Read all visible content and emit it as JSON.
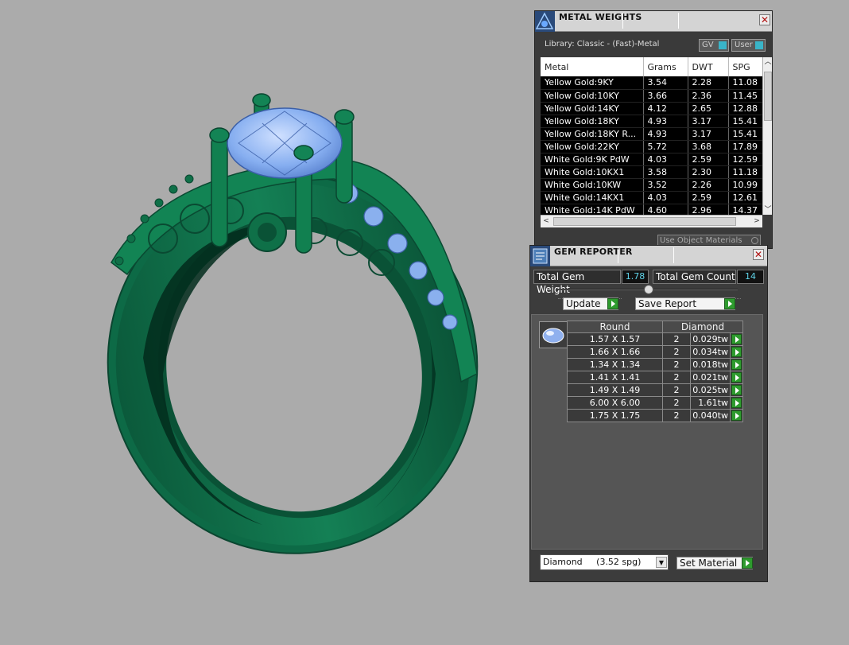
{
  "metal_weights": {
    "title": "METAL WEIGHTS",
    "library": "Library: Classic - (Fast)-Metal",
    "toggle_gv": "GV",
    "toggle_user": "User",
    "columns": [
      "Metal",
      "Grams",
      "DWT",
      "SPG"
    ],
    "rows": [
      [
        "Yellow Gold:9KY",
        "3.54",
        "2.28",
        "11.08"
      ],
      [
        "Yellow Gold:10KY",
        "3.66",
        "2.36",
        "11.45"
      ],
      [
        "Yellow Gold:14KY",
        "4.12",
        "2.65",
        "12.88"
      ],
      [
        "Yellow Gold:18KY",
        "4.93",
        "3.17",
        "15.41"
      ],
      [
        "Yellow Gold:18KY R...",
        "4.93",
        "3.17",
        "15.41"
      ],
      [
        "Yellow Gold:22KY",
        "5.72",
        "3.68",
        "17.89"
      ],
      [
        "White Gold:9K PdW",
        "4.03",
        "2.59",
        "12.59"
      ],
      [
        "White Gold:10KX1",
        "3.58",
        "2.30",
        "11.18"
      ],
      [
        "White Gold:10KW",
        "3.52",
        "2.26",
        "10.99"
      ],
      [
        "White Gold:14KX1",
        "4.03",
        "2.59",
        "12.61"
      ],
      [
        "White Gold:14K PdW",
        "4.60",
        "2.96",
        "14.37"
      ]
    ],
    "use_object_materials": "Use Object Materials"
  },
  "gem_reporter": {
    "title": "GEM REPORTER",
    "total_weight_label": "Total Gem Weight",
    "total_weight_value": "1.78",
    "total_count_label": "Total Gem Count",
    "total_count_value": "14",
    "update_label": "Update",
    "save_report_label": "Save Report",
    "table_headers": [
      "Round",
      "Diamond"
    ],
    "gems": [
      [
        "1.57 X 1.57",
        "2",
        "0.029tw"
      ],
      [
        "1.66 X 1.66",
        "2",
        "0.034tw"
      ],
      [
        "1.34 X 1.34",
        "2",
        "0.018tw"
      ],
      [
        "1.41 X 1.41",
        "2",
        "0.021tw"
      ],
      [
        "1.49 X 1.49",
        "2",
        "0.025tw"
      ],
      [
        "6.00 X 6.00",
        "2",
        "1.61tw"
      ],
      [
        "1.75 X 1.75",
        "2",
        "0.040tw"
      ]
    ],
    "material_select": "Diamond     (3.52 spg)",
    "set_material_label": "Set Material"
  },
  "colors": {
    "ring_metal": "#137a52",
    "gem": "#8fb4f0",
    "accent_value": "#5fd3e8",
    "go_button": "#2e9b2e"
  }
}
